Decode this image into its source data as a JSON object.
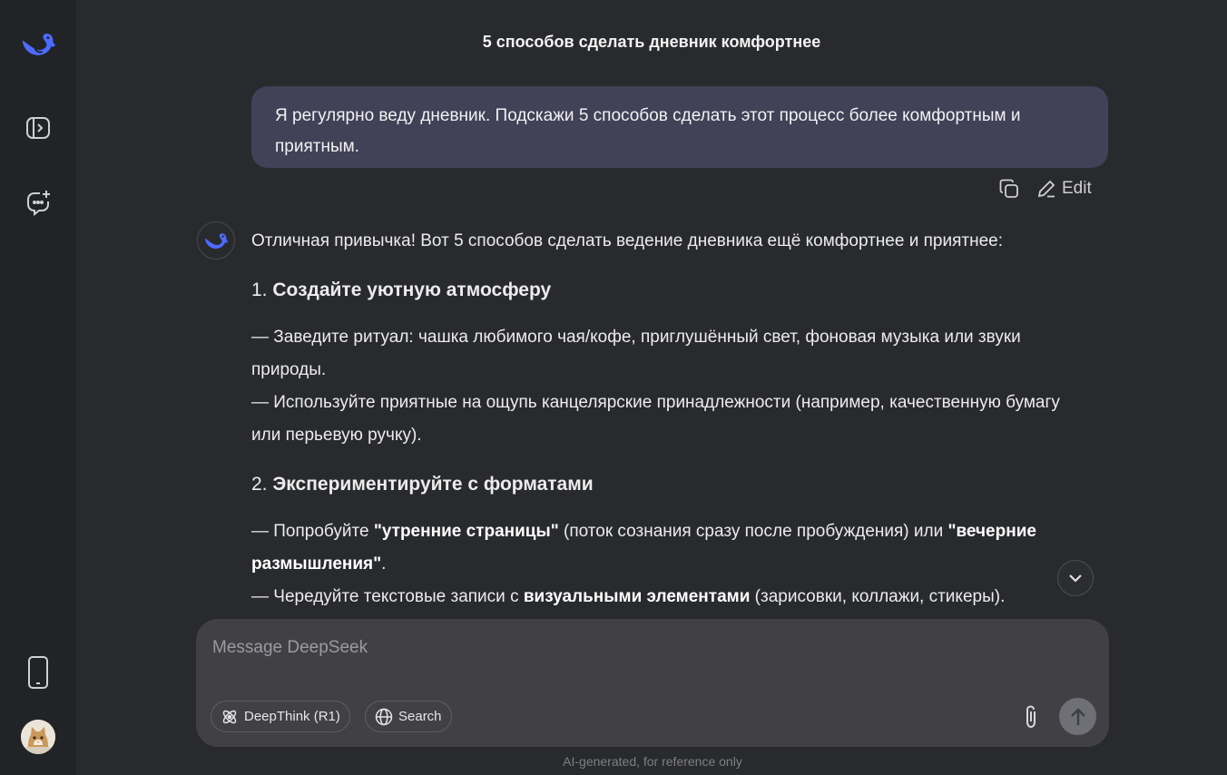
{
  "colors": {
    "accent": "#4d6bfe",
    "background": "#292a2d",
    "sidebar": "#212327",
    "user_bubble": "#414158",
    "composer": "#404045"
  },
  "sidebar": {
    "logo_icon": "deepseek-whale-icon",
    "items": [
      {
        "icon": "open-sidebar-icon"
      },
      {
        "icon": "new-chat-icon"
      }
    ],
    "bottom": [
      {
        "icon": "mobile-app-icon"
      },
      {
        "icon": "user-avatar-cat"
      }
    ]
  },
  "header": {
    "title": "5 способов сделать дневник комфортнее"
  },
  "conversation": {
    "user_message": "Я регулярно веду дневник. Подскажи 5 способов сделать этот процесс более комфортным и приятным.",
    "actions": {
      "copy_icon": "copy-icon",
      "edit_label": "Edit"
    },
    "answer": {
      "intro": "Отличная привычка! Вот 5 способов сделать ведение дневника ещё комфортнее и приятнее:",
      "section1": {
        "num": "1.",
        "heading": "Создайте уютную атмосферу",
        "line1": "— Заведите ритуал: чашка любимого чая/кофе, приглушённый свет, фоновая музыка или звуки природы.",
        "line2": "— Используйте приятные на ощупь канцелярские принадлежности (например, качественную бумагу или перьевую ручку)."
      },
      "section2": {
        "num": "2.",
        "heading": "Экспериментируйте с форматами",
        "l1_a": "— Попробуйте ",
        "l1_b1": "\"утренние страницы\"",
        "l1_c": " (поток сознания сразу после пробуждения) или ",
        "l1_b2": "\"вечерние размышления\"",
        "l1_d": ".",
        "l2_a": "— Чередуйте текстовые записи с ",
        "l2_b": "визуальными элементами",
        "l2_c": " (зарисовки, коллажи, стикеры)."
      }
    }
  },
  "composer": {
    "placeholder": "Message DeepSeek",
    "deepthink_label": "DeepThink (R1)",
    "search_label": "Search"
  },
  "footer": {
    "note": "AI-generated, for reference only"
  }
}
